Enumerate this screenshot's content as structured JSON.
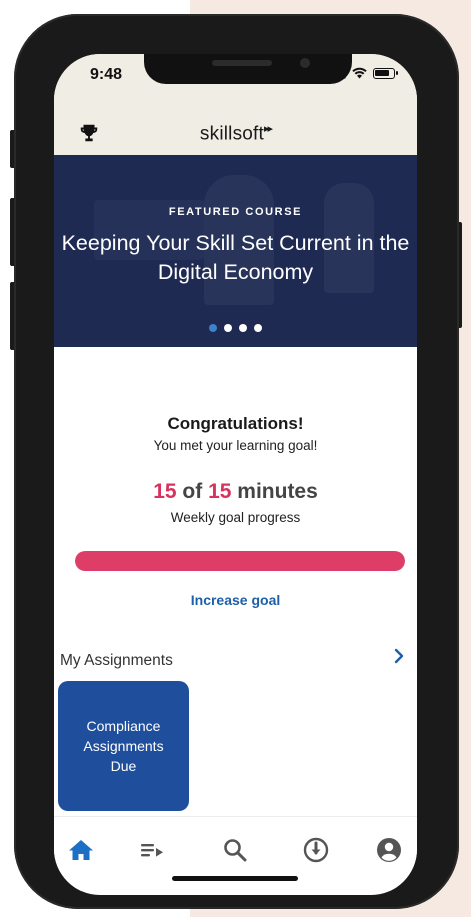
{
  "status_bar": {
    "time": "9:48"
  },
  "header": {
    "logo_text": "skillsoft",
    "trophy_icon": "trophy-icon"
  },
  "featured": {
    "tag": "FEATURED COURSE",
    "title": "Keeping Your Skill Set Current in the Digital Economy",
    "slides": 4,
    "active_slide": 1
  },
  "goal": {
    "headline": "Congratulations!",
    "subline": "You met your learning goal!",
    "completed": "15",
    "of": "of",
    "target": "15",
    "unit": "minutes",
    "caption": "Weekly goal progress",
    "progress_fraction": 1.0,
    "increase_label": "Increase goal"
  },
  "assignments": {
    "title": "My Assignments",
    "cards": [
      {
        "label": "Compliance Assignments Due"
      }
    ]
  },
  "nav": {
    "items": [
      {
        "icon": "home-icon",
        "active": true
      },
      {
        "icon": "playlist-icon",
        "active": false
      },
      {
        "icon": "search-icon",
        "active": false
      },
      {
        "icon": "download-icon",
        "active": false
      },
      {
        "icon": "profile-icon",
        "active": false
      }
    ]
  },
  "colors": {
    "accent_pink": "#dd3d66",
    "link_blue": "#1d5fa8",
    "hero_bg": "#1e2a52",
    "card_blue": "#1f4f9c",
    "nav_active": "#1d6fc4"
  }
}
